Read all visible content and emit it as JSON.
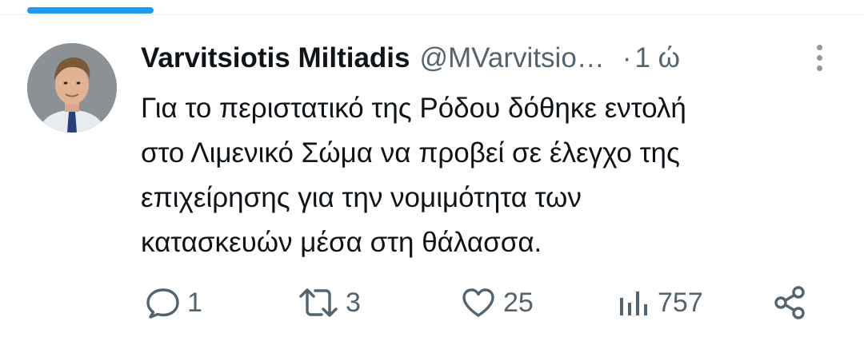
{
  "tweet": {
    "author": {
      "display_name": "Varvitsiotis Miltiadis",
      "handle": "@MVarvitsio…"
    },
    "separator": "·",
    "time": "1 ώ",
    "text_lines": [
      "Για το περιστατικό της Ρόδου δόθηκε εντολή",
      "στο Λιμενικό Σώμα να προβεί σε έλεγχο της",
      "επιχείρησης για την νομιμότητα των",
      "κατασκευών μέσα στη θάλασσα."
    ],
    "actions": {
      "replies": "1",
      "retweets": "3",
      "likes": "25",
      "views": "757"
    }
  },
  "icons": {
    "reply": "reply-bubble-icon",
    "retweet": "retweet-arrows-icon",
    "like": "heart-icon",
    "views": "views-bar-chart-icon",
    "share": "share-nodes-icon",
    "more": "more-vertical-dots-icon"
  },
  "colors": {
    "accent": "#1d9bf0",
    "text": "#0f1419",
    "secondary": "#536471"
  }
}
